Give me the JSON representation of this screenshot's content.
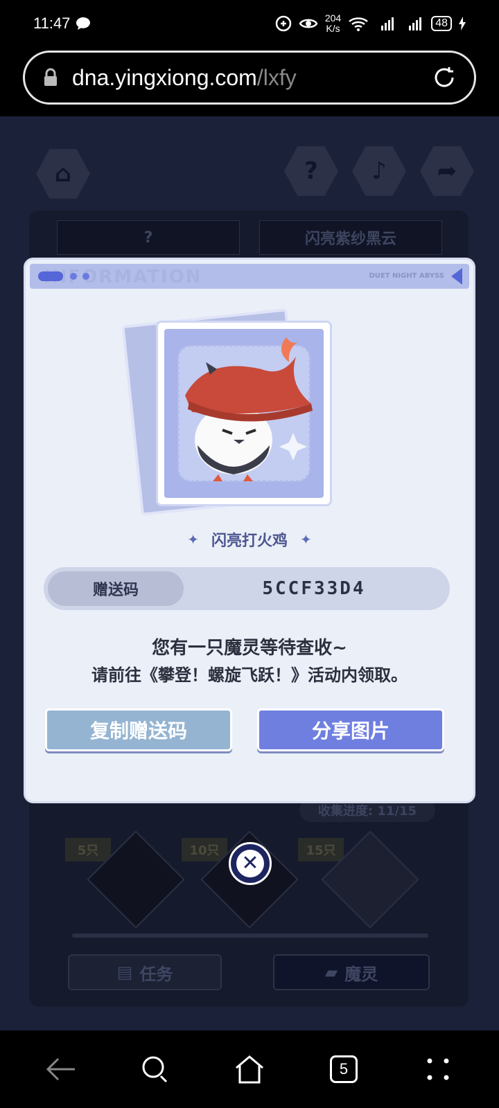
{
  "status_bar": {
    "time": "11:47",
    "net_speed_value": "204",
    "net_speed_unit": "K/s",
    "battery": "48"
  },
  "browser": {
    "url_host": "dna.yingxiong.com",
    "url_path": "/lxfy",
    "tab_count": "5"
  },
  "background": {
    "tab_left": "?",
    "tab_right": "闪亮紫纱黑云",
    "progress": "收集进度: 11/15",
    "milestones": [
      "5只",
      "10只",
      "15只"
    ],
    "button_task": "任务",
    "button_pet": "魔灵"
  },
  "dialog": {
    "header_watermark": "INFORMATION",
    "header_brand": "DUET NIGHT ABYSS",
    "pet_name": "闪亮打火鸡",
    "code_label": "赠送码",
    "code_value": "5CCF33D4",
    "message_line1": "您有一只魔灵等待查收~",
    "message_line2": "请前往《攀登！螺旋飞跃！》活动内领取。",
    "copy_button": "复制赠送码",
    "share_button": "分享图片"
  },
  "colors": {
    "dialog_bg": "#ebeff8",
    "share_button": "#6f7fe0",
    "copy_button": "#94b4d2",
    "accent": "#5566d8"
  }
}
